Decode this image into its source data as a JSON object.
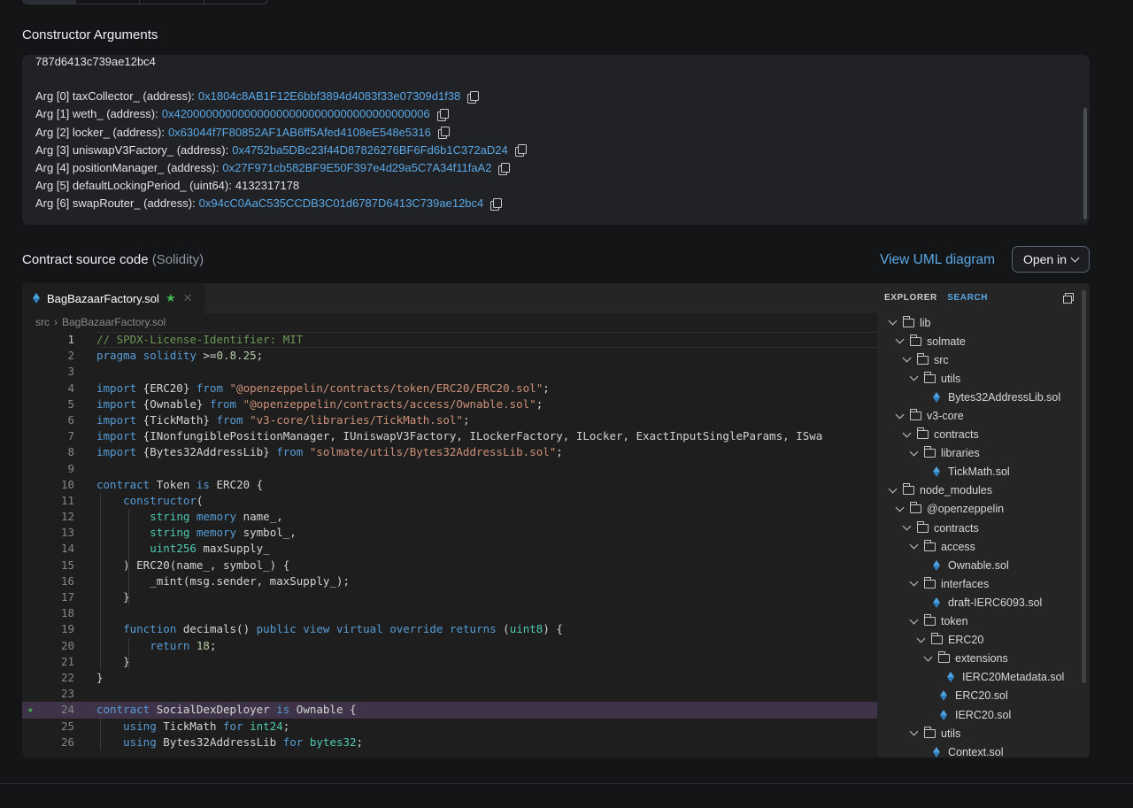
{
  "constructor_args": {
    "title": "Constructor Arguments",
    "encoded_tail": "787d6413c739ae12bc4",
    "args": [
      {
        "label": "Arg [0] taxCollector_ (address):",
        "value": "0x1804c8AB1F12E6bbf3894d4083f33e07309d1f38",
        "is_address": true
      },
      {
        "label": "Arg [1] weth_ (address):",
        "value": "0x4200000000000000000000000000000000000006",
        "is_address": true
      },
      {
        "label": "Arg [2] locker_ (address):",
        "value": "0x63044f7F80852AF1AB6ff5Afed4108eE548e5316",
        "is_address": true
      },
      {
        "label": "Arg [3] uniswapV3Factory_ (address):",
        "value": "0x4752ba5DBc23f44D87826276BF6Fd6b1C372aD24",
        "is_address": true
      },
      {
        "label": "Arg [4] positionManager_ (address):",
        "value": "0x27F971cb582BF9E50F397e4d29a5C7A34f11faA2",
        "is_address": true
      },
      {
        "label": "Arg [5] defaultLockingPeriod_ (uint64):",
        "value": "4132317178",
        "is_address": false
      },
      {
        "label": "Arg [6] swapRouter_ (address):",
        "value": "0x94cC0AaC535CCDB3C01d6787D6413C739ae12bc4",
        "is_address": true
      }
    ]
  },
  "source": {
    "title": "Contract source code",
    "language": "(Solidity)",
    "uml_link": "View UML diagram",
    "open_in": "Open in"
  },
  "editor": {
    "tab_label": "BagBazaarFactory.sol",
    "breadcrumb": [
      "src",
      "BagBazaarFactory.sol"
    ],
    "active_line": 1,
    "highlight_line": 24,
    "lines": [
      "// SPDX-License-Identifier: MIT",
      "pragma solidity >=0.8.25;",
      "",
      "import {ERC20} from \"@openzeppelin/contracts/token/ERC20/ERC20.sol\";",
      "import {Ownable} from \"@openzeppelin/contracts/access/Ownable.sol\";",
      "import {TickMath} from \"v3-core/libraries/TickMath.sol\";",
      "import {INonfungiblePositionManager, IUniswapV3Factory, ILockerFactory, ILocker, ExactInputSingleParams, ISwa",
      "import {Bytes32AddressLib} from \"solmate/utils/Bytes32AddressLib.sol\";",
      "",
      "contract Token is ERC20 {",
      "    constructor(",
      "        string memory name_,",
      "        string memory symbol_,",
      "        uint256 maxSupply_",
      "    ) ERC20(name_, symbol_) {",
      "        _mint(msg.sender, maxSupply_);",
      "    }",
      "",
      "    function decimals() public view virtual override returns (uint8) {",
      "        return 18;",
      "    }",
      "}",
      "",
      "contract SocialDexDeployer is Ownable {",
      "    using TickMath for int24;",
      "    using Bytes32AddressLib for bytes32;"
    ]
  },
  "explorer": {
    "title": "EXPLORER",
    "search": "SEARCH",
    "tree": [
      {
        "label": "lib",
        "depth": 0,
        "type": "folder"
      },
      {
        "label": "solmate",
        "depth": 1,
        "type": "folder"
      },
      {
        "label": "src",
        "depth": 2,
        "type": "folder"
      },
      {
        "label": "utils",
        "depth": 3,
        "type": "folder"
      },
      {
        "label": "Bytes32AddressLib.sol",
        "depth": 4,
        "type": "file"
      },
      {
        "label": "v3-core",
        "depth": 1,
        "type": "folder"
      },
      {
        "label": "contracts",
        "depth": 2,
        "type": "folder"
      },
      {
        "label": "libraries",
        "depth": 3,
        "type": "folder"
      },
      {
        "label": "TickMath.sol",
        "depth": 4,
        "type": "file"
      },
      {
        "label": "node_modules",
        "depth": 0,
        "type": "folder"
      },
      {
        "label": "@openzeppelin",
        "depth": 1,
        "type": "folder"
      },
      {
        "label": "contracts",
        "depth": 2,
        "type": "folder"
      },
      {
        "label": "access",
        "depth": 3,
        "type": "folder"
      },
      {
        "label": "Ownable.sol",
        "depth": 4,
        "type": "file"
      },
      {
        "label": "interfaces",
        "depth": 3,
        "type": "folder"
      },
      {
        "label": "draft-IERC6093.sol",
        "depth": 4,
        "type": "file"
      },
      {
        "label": "token",
        "depth": 3,
        "type": "folder"
      },
      {
        "label": "ERC20",
        "depth": 4,
        "type": "folder"
      },
      {
        "label": "extensions",
        "depth": 5,
        "type": "folder"
      },
      {
        "label": "IERC20Metadata.sol",
        "depth": 6,
        "type": "file"
      },
      {
        "label": "ERC20.sol",
        "depth": 5,
        "type": "file"
      },
      {
        "label": "IERC20.sol",
        "depth": 5,
        "type": "file"
      },
      {
        "label": "utils",
        "depth": 3,
        "type": "folder"
      },
      {
        "label": "Context.sol",
        "depth": 4,
        "type": "file"
      }
    ]
  }
}
